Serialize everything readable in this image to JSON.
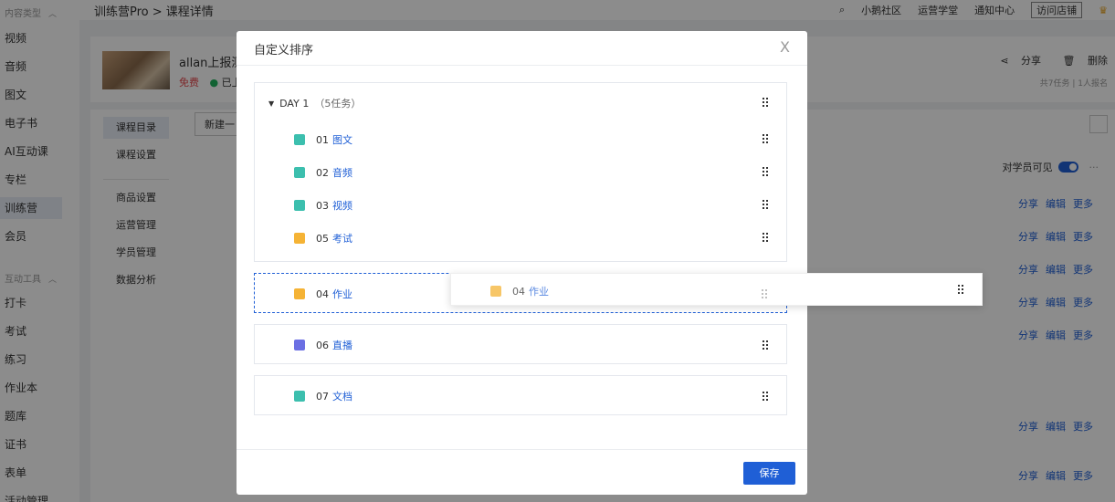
{
  "left_nav": {
    "group1": "内容类型",
    "items1": [
      "视频",
      "音频",
      "图文",
      "电子书",
      "AI互动课",
      "专栏",
      "训练营",
      "会员"
    ],
    "group2": "互动工具",
    "items2": [
      "打卡",
      "考试",
      "练习",
      "作业本",
      "题库",
      "证书",
      "表单",
      "活动管理"
    ]
  },
  "topbar": {
    "breadcrumb": "训练营Pro > 课程详情",
    "links": [
      "小鹅社区",
      "运营学堂",
      "通知中心"
    ],
    "visit": "访问店铺"
  },
  "course": {
    "title": "allan上报测",
    "price": "免费",
    "status": "已上",
    "share": "分享",
    "delete": "删除",
    "stats": "共7任务 | 1人报名"
  },
  "sub_nav": [
    "课程目录",
    "课程设置",
    "商品设置",
    "运营管理",
    "学员管理",
    "数据分析"
  ],
  "toolbar": {
    "new": "新建一",
    "visible": "对学员可见",
    "more": "···"
  },
  "row_actions": {
    "share": "分享",
    "edit": "编辑",
    "more": "更多"
  },
  "modal": {
    "title": "自定义排序",
    "close": "X",
    "save": "保存",
    "day": {
      "label": "DAY 1",
      "count": "（5任务）"
    },
    "tasks": [
      {
        "num": "01",
        "name": "图文"
      },
      {
        "num": "02",
        "name": "音频"
      },
      {
        "num": "03",
        "name": "视频"
      },
      {
        "num": "05",
        "name": "考试"
      }
    ],
    "dragging": {
      "num": "04",
      "name": "作业"
    },
    "others": [
      {
        "num": "06",
        "name": "直播"
      },
      {
        "num": "07",
        "name": "文档"
      }
    ]
  },
  "colors": {
    "accent": "#1f5fd6",
    "teal": "#3cbfae",
    "orange": "#f5b335",
    "purple": "#6b6fe3",
    "green": "#22b35e",
    "red": "#e5484d"
  }
}
